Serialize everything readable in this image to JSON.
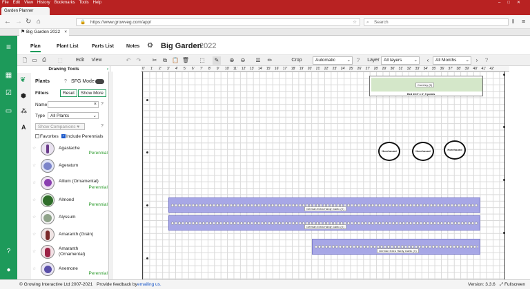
{
  "window": {
    "menu": [
      "File",
      "Edit",
      "View",
      "History",
      "Bookmarks",
      "Tools",
      "Help"
    ],
    "title": "Garden Planner"
  },
  "browser": {
    "tab_title": "Big Garden 2022",
    "url": "https://www.growveg.com/app/",
    "search_placeholder": "Search"
  },
  "app": {
    "tab_label": "Big Garden 2022",
    "nav": [
      "Plan",
      "Plant List",
      "Parts List",
      "Notes"
    ],
    "plan_name": "Big Garden",
    "plan_year": "2022"
  },
  "toolbar": {
    "edit_label": "Edit",
    "view_label": "View",
    "crop_rotation_label": "Crop Rotation",
    "crop_rotation_value": "Automatic",
    "layer_label": "Layer",
    "layer_value": "All layers",
    "months_value": "All Months"
  },
  "sidebar": {
    "header": "Drawing Tools",
    "plants_label": "Plants",
    "sfg_label": "SFG Mode",
    "filters_label": "Filters",
    "reset_label": "Reset",
    "show_more_label": "Show More",
    "name_label": "Name",
    "name_value": "",
    "type_label": "Type",
    "type_value": "All Plants",
    "show_companions_label": "Show Companions",
    "favorites_label": "Favorites",
    "include_perennials_label": "Include Perennials",
    "favorites_checked": false,
    "include_perennials_checked": true,
    "plants": [
      {
        "name": "Agastache",
        "tag": "Perennial"
      },
      {
        "name": "Ageratum",
        "tag": ""
      },
      {
        "name": "Allium (Ornamental)",
        "tag": "Perennial"
      },
      {
        "name": "Almond",
        "tag": "Perennial"
      },
      {
        "name": "Alyssum",
        "tag": ""
      },
      {
        "name": "Amaranth (Grain)",
        "tag": ""
      },
      {
        "name": "Amaranth (Ornamental)",
        "tag": ""
      },
      {
        "name": "Anemone",
        "tag": "Perennial"
      }
    ]
  },
  "ruler": {
    "top_ticks": [
      "0'",
      "1'",
      "2'",
      "3'",
      "4'",
      "5'",
      "6'",
      "7'",
      "8'",
      "9'",
      "10'",
      "11'",
      "12'",
      "13'",
      "14'",
      "15'",
      "16'",
      "17'",
      "18'",
      "19'",
      "20'",
      "21'",
      "22'",
      "23'",
      "24'",
      "25'",
      "26'",
      "27'",
      "28'",
      "29'",
      "30'",
      "31'",
      "32'",
      "33'",
      "34'",
      "35'",
      "36'",
      "37'",
      "38'",
      "39'",
      "40'",
      "41'",
      "42'"
    ]
  },
  "canvas": {
    "comfrey_label": "Comfrey (5)",
    "bed_label": "Bed 15.0' x 3', 9 points",
    "horehound_label": "Horehound",
    "garlic_rows": [
      {
        "label": "German Extra Hardy Garlic (X)"
      },
      {
        "label": "German Extra Hardy Garlic (X)"
      },
      {
        "label": "German Extra Hardy Garlic (X)"
      }
    ]
  },
  "footer": {
    "copyright": "© Growing Interactive Ltd 2007-2021",
    "feedback_prefix": "Provide feedback by",
    "feedback_link": "emailing us.",
    "version": "Version: 3.3.6",
    "fullscreen": "Fullscreen"
  },
  "colors": {
    "brand_green": "#1d9a5a",
    "browser_red": "#b82222",
    "bed_fill": "#a7a7e6"
  }
}
